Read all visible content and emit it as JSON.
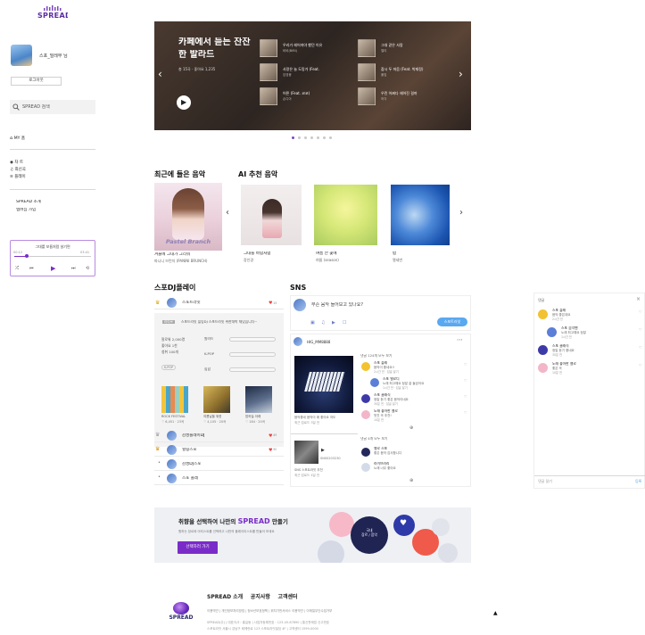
{
  "brand": {
    "logo_text": "SPREAD",
    "purple": "#7a2cc8",
    "accent": "#5b2ca0"
  },
  "sidebar": {
    "user_name": "스포_밀레부 님",
    "login_button": "로그아웃",
    "search_placeholder": "SPREAD 검색",
    "nav_home": "MY 홈",
    "nav_group": [
      "차 트",
      "최신곡",
      "플레이"
    ],
    "nav_links": [
      "SPREAD 소개",
      "멤버십 가입"
    ],
    "player": {
      "track": "그대를 보름처럼 살기면",
      "time_start": "00:12",
      "time_end": "03:41"
    }
  },
  "banner": {
    "title_line1": "카페에서 듣는 잔잔",
    "title_line2": "한 발라드",
    "meta": "총 15곡 · 좋아요 1,235",
    "tracks": [
      {
        "title": "우리가 헤어져야 했던 이유",
        "artist": "비비(BIBI)"
      },
      {
        "title": "사랑은 늘 도망가 (Feat.",
        "artist": "임영웅"
      },
      {
        "title": "어른 (Feat. 코코)",
        "artist": "손디아"
      },
      {
        "title": "그대 같은 사람",
        "artist": "엘리"
      },
      {
        "title": "잠시 두 마음 (Feat. 박재정)",
        "artist": "폴킴"
      },
      {
        "title": "우린 어쩌다 헤어진 걸까",
        "artist": "허각"
      }
    ],
    "page_count": 7,
    "active_page": 0
  },
  "recent": {
    "title": "최근에 들은 음악",
    "album_text": "Pastel Branch",
    "track_title": "겨울에 그대가 그리워",
    "track_artist": "파니니 브런치 (PANINI BRUNCH)"
  },
  "ai": {
    "title": "AI 추천 음악",
    "items": [
      {
        "title": "그대를 바람처럼",
        "artist": "장인경"
      },
      {
        "title": "여름 안 꽃에",
        "artist": "여름 (season)"
      },
      {
        "title": "밤",
        "artist": "열세번"
      }
    ]
  },
  "dj": {
    "title": "스포DJ플레이",
    "top_name": "스포트라잇",
    "top_badge": "15",
    "tag": "라이브",
    "desc": "스포트라잇 힐링DJ 스포트라잇 위한대박 재밌습니다~",
    "stats": [
      {
        "k": "팔로워",
        "v": "2,000명"
      },
      {
        "k": "좋아요",
        "v": "1천"
      },
      {
        "k": "청취",
        "v": "100개"
      }
    ],
    "genres": [
      "발라드",
      "K-POP",
      "힙합"
    ],
    "chip": "K-POP",
    "covers": [
      {
        "title": "ROCK FESTIVAL",
        "meta": "♡ 6,451 · 23곡"
      },
      {
        "title": "여름날을 위한",
        "meta": "♡ 4,105 · 20곡"
      },
      {
        "title": "밤하늘 아래",
        "meta": "♡ 184 · 20곡"
      }
    ],
    "list": [
      {
        "name": "감성플레이DJ",
        "count": "49"
      },
      {
        "name": "힐링스포",
        "count": "30"
      },
      {
        "name": "감성DJ스포",
        "count": ""
      },
      {
        "name": "스포 플레",
        "count": ""
      }
    ]
  },
  "sns": {
    "title": "SNS",
    "prompt": "무슨 음악 들어보고 있나요?",
    "post_button": "스포트라잇",
    "post_user": "HIG_MM8888",
    "post_caption": "음악좋네 음악이 꽤 좋아요 저도",
    "post_time": "최근 업로드 3일 전",
    "comments_header": "댓글 124개 모두 보기",
    "comments": [
      {
        "name": "스포 플레",
        "text": "음악이 좋네요!!",
        "time": "2시간 전 · 답글 달기"
      },
      {
        "name": "스포 멜로디",
        "text": "노래 최고예요 정말 잘 들었어요",
        "time": "1시간 전 · 답글 달기"
      },
      {
        "name": "스포 클래식",
        "text": "정말 듣기 좋은 음악이네요",
        "time": "30분 전 · 답글 달기"
      },
      {
        "name": "노래 좋아한 멜로",
        "text": "멋진 곡 추천!",
        "time": "10분 전"
      }
    ],
    "post2_caption": "SNS 스포트라잇 추천",
    "post2_header": "댓글 4개 모두 보기",
    "post2_comments": [
      {
        "name": "멜로 스포",
        "text": "좋은 음악 감사합니다"
      },
      {
        "name": "라이브러리",
        "text": "노래 너무 좋아요"
      }
    ],
    "post2_user": "SNS0203230",
    "post2_sub": "오늘의 추천곡 두 곡",
    "post2_time": "최근 업로드 4일 전"
  },
  "side_panel": {
    "title": "댓글",
    "items": [
      {
        "name": "스포 플레",
        "text": "음악 좋은데요",
        "time": "2시간 전",
        "color": "#f2c230"
      },
      {
        "name": "스포 음악팬",
        "text": "노래 최고예요 정말",
        "time": "1시간 전",
        "color": "#5b7fd6"
      },
      {
        "name": "스포 클래식",
        "text": "정말 듣기 좋네요",
        "time": "30분 전",
        "color": "#3d3aa8"
      },
      {
        "name": "노래 좋아한 멜로",
        "text": "좋은 곡",
        "time": "10분 전",
        "color": "#f2b6c8"
      }
    ],
    "input_placeholder": "댓글 달기",
    "submit": "등록"
  },
  "promo": {
    "title_pre": "취향을 선택하여 나만의 ",
    "title_brand": "SPREAD",
    "title_post": " 만들기",
    "sub": "원하는 장르와 아티스트를 선택하고 나만의 플레이리스트를 만들어 보세요",
    "button": "선택하러 가기",
    "bubble_center": "국내\n장르 / 음악"
  },
  "footer": {
    "links": [
      "SPREAD 소개",
      "공지사항",
      "고객센터"
    ],
    "small_links": [
      "이용약관",
      "개인정보처리방침",
      "청소년보호정책",
      "위치기반서비스 이용약관",
      "이메일무단수집거부"
    ],
    "info1": "SPREAD(주) | 대표이사 : 홍길동 | 사업자등록번호 : 123-45-67890 | 통신판매업 신고번호",
    "info2": "스포트라잇 서울시 강남구 테헤란로 123 스포트라잇빌딩 4F | 고객센터 1599-0000"
  }
}
